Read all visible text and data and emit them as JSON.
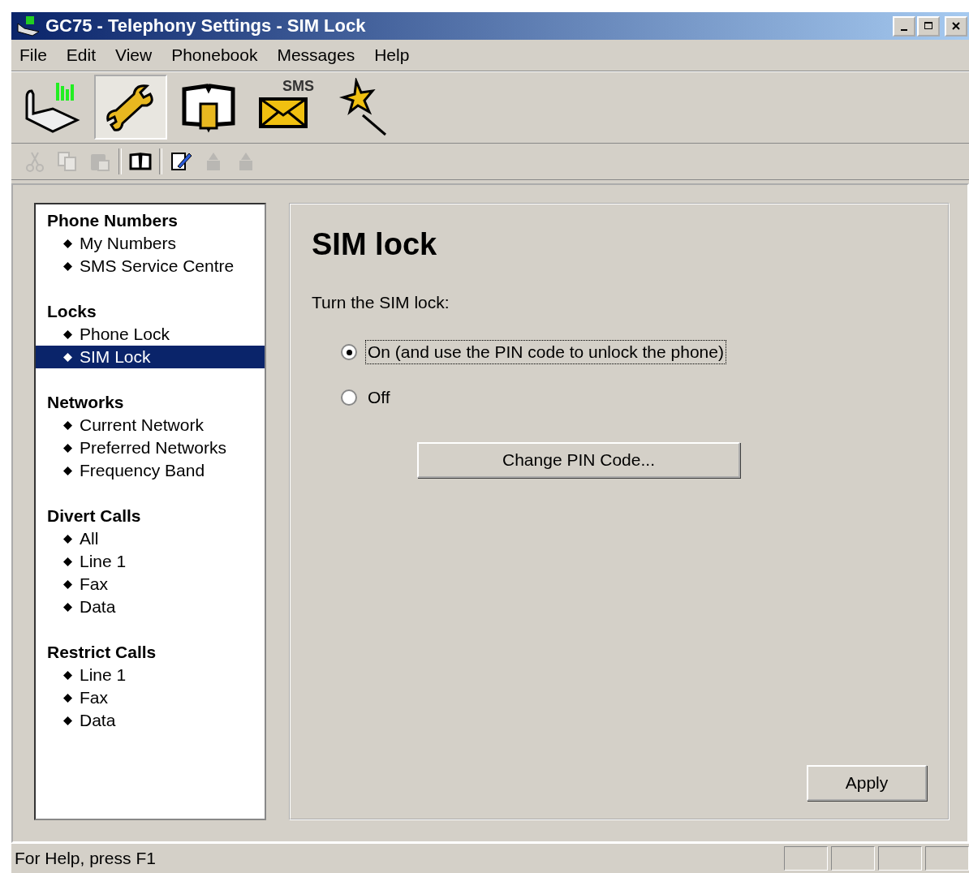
{
  "window": {
    "title": "GC75 - Telephony Settings - SIM Lock"
  },
  "menu": [
    {
      "label": "File"
    },
    {
      "label": "Edit"
    },
    {
      "label": "View"
    },
    {
      "label": "Phonebook"
    },
    {
      "label": "Messages"
    },
    {
      "label": "Help"
    }
  ],
  "toolbar": [
    {
      "kind": "modem",
      "selected": false
    },
    {
      "kind": "wrench",
      "selected": true
    },
    {
      "kind": "phonebook",
      "selected": false
    },
    {
      "kind": "sms",
      "selected": false,
      "label": "SMS"
    },
    {
      "kind": "wand",
      "selected": false
    }
  ],
  "small_toolbar": [
    {
      "kind": "cut",
      "disabled": true
    },
    {
      "kind": "copy",
      "disabled": true
    },
    {
      "kind": "paste",
      "disabled": true
    },
    {
      "kind": "separator"
    },
    {
      "kind": "book",
      "disabled": false
    },
    {
      "kind": "separator"
    },
    {
      "kind": "edit",
      "disabled": false
    },
    {
      "kind": "upload",
      "disabled": true
    },
    {
      "kind": "export",
      "disabled": true
    }
  ],
  "nav": [
    {
      "title": "Phone Numbers",
      "items": [
        {
          "label": "My Numbers",
          "selected": false
        },
        {
          "label": "SMS Service Centre",
          "selected": false
        }
      ]
    },
    {
      "title": "Locks",
      "items": [
        {
          "label": "Phone Lock",
          "selected": false
        },
        {
          "label": "SIM Lock",
          "selected": true
        }
      ]
    },
    {
      "title": "Networks",
      "items": [
        {
          "label": "Current Network",
          "selected": false
        },
        {
          "label": "Preferred Networks",
          "selected": false
        },
        {
          "label": "Frequency Band",
          "selected": false
        }
      ]
    },
    {
      "title": "Divert Calls",
      "items": [
        {
          "label": "All",
          "selected": false
        },
        {
          "label": "Line 1",
          "selected": false
        },
        {
          "label": "Fax",
          "selected": false
        },
        {
          "label": "Data",
          "selected": false
        }
      ]
    },
    {
      "title": "Restrict Calls",
      "items": [
        {
          "label": "Line 1",
          "selected": false
        },
        {
          "label": "Fax",
          "selected": false
        },
        {
          "label": "Data",
          "selected": false
        }
      ]
    }
  ],
  "panel": {
    "heading": "SIM lock",
    "prompt": "Turn the SIM lock:",
    "options": [
      {
        "label": "On (and use the PIN code to unlock the phone)",
        "selected": true,
        "focused": true
      },
      {
        "label": "Off",
        "selected": false,
        "focused": false
      }
    ],
    "change_button": "Change PIN Code...",
    "apply_button": "Apply"
  },
  "status_bar": {
    "text": "For Help, press F1"
  }
}
